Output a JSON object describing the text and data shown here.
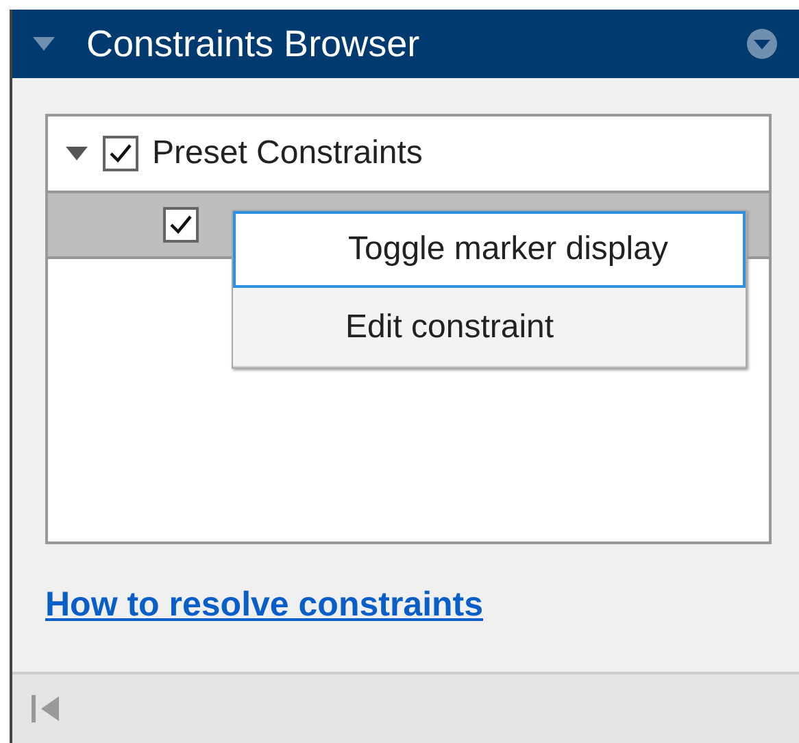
{
  "panel": {
    "title": "Constraints Browser",
    "expanded": true
  },
  "tree": [
    {
      "label": "Preset Constraints",
      "expanded": true,
      "checked": true,
      "selected": false,
      "children": [
        {
          "checked": true,
          "selected": true
        }
      ]
    }
  ],
  "context_menu": [
    {
      "label": "Toggle marker display",
      "selected": true
    },
    {
      "label": "Edit constraint",
      "selected": false
    }
  ],
  "link": "How to resolve constraints"
}
